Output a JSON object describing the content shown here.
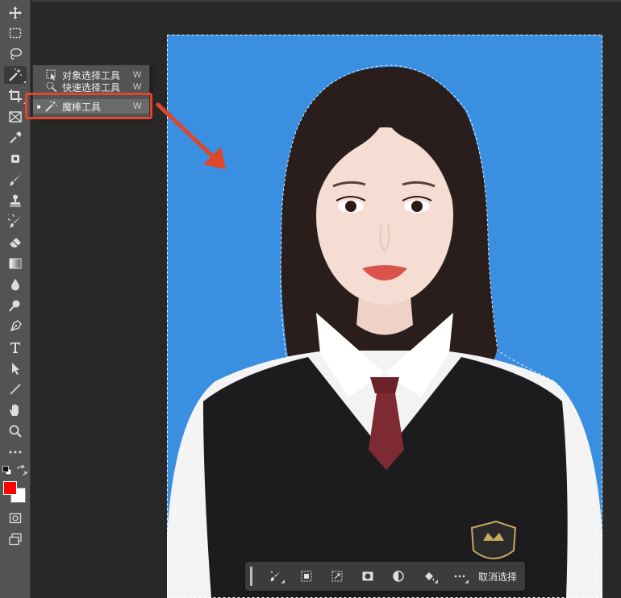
{
  "flyout": {
    "items": [
      {
        "label": "对象选择工具",
        "key": "W",
        "icon": "object-selection-icon"
      },
      {
        "label": "快速选择工具",
        "key": "W",
        "icon": "quick-selection-icon"
      },
      {
        "label": "魔棒工具",
        "key": "W",
        "icon": "magic-wand-icon",
        "selected": true
      }
    ]
  },
  "colors": {
    "foreground": "#ff0000",
    "background": "#ffffff",
    "photo_background": "#3a8fe0",
    "highlight": "#e0472a"
  },
  "contextual_taskbar": {
    "deselect_label": "取消选择"
  }
}
